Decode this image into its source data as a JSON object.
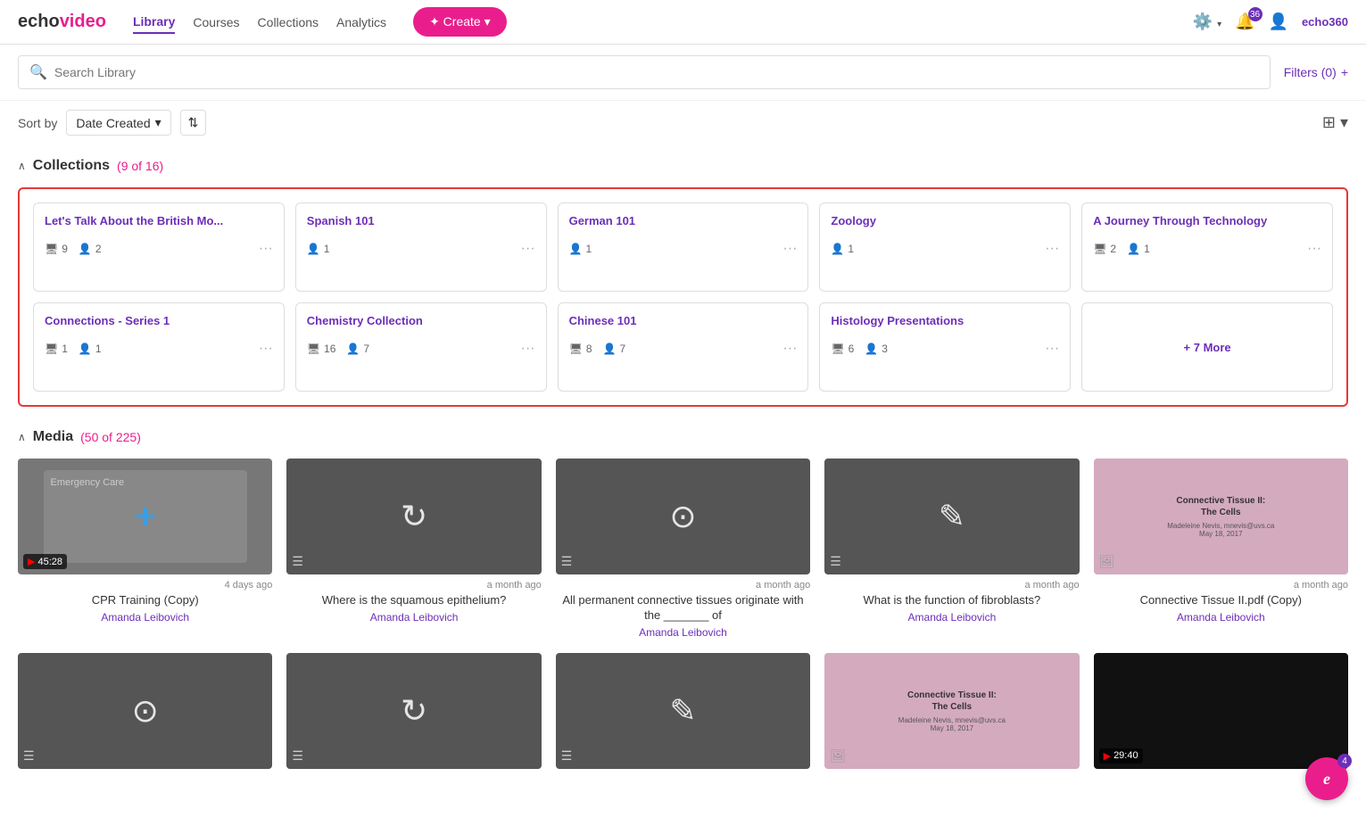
{
  "app": {
    "name_echo": "echo",
    "name_video": "video"
  },
  "nav": {
    "items": [
      {
        "label": "Library",
        "active": true
      },
      {
        "label": "Courses",
        "active": false
      },
      {
        "label": "Collections",
        "active": false
      },
      {
        "label": "Analytics",
        "active": false
      }
    ],
    "create_label": "✦ Create ▾"
  },
  "header_right": {
    "settings_label": "⚙",
    "bell_label": "🔔",
    "bell_badge": "36",
    "avatar_label": "👤",
    "brand_label": "echo360"
  },
  "search": {
    "placeholder": "Search Library",
    "filters_label": "Filters (0)",
    "filters_plus": "+"
  },
  "sort": {
    "label": "Sort by",
    "selected": "Date Created",
    "sort_icon": "⇅",
    "view_icon": "⊞ ▾"
  },
  "collections_section": {
    "title": "Collections",
    "count": "(9 of 16)",
    "chevron": "∧",
    "cards": [
      {
        "title": "Let's Talk About the British Mo...",
        "media_count": "9",
        "people_count": "2"
      },
      {
        "title": "Spanish 101",
        "media_count": "",
        "people_count": "1"
      },
      {
        "title": "German 101",
        "media_count": "",
        "people_count": "1"
      },
      {
        "title": "Zoology",
        "media_count": "",
        "people_count": "1"
      },
      {
        "title": "A Journey Through Technology",
        "media_count": "2",
        "people_count": "1"
      },
      {
        "title": "Connections - Series 1",
        "media_count": "1",
        "people_count": "1"
      },
      {
        "title": "Chemistry Collection",
        "media_count": "16",
        "people_count": "7"
      },
      {
        "title": "Chinese 101",
        "media_count": "8",
        "people_count": "7"
      },
      {
        "title": "Histology Presentations",
        "media_count": "6",
        "people_count": "3"
      }
    ],
    "more_label": "+ 7 More"
  },
  "media_section": {
    "title": "Media",
    "count": "(50 of 225)",
    "chevron": "∧",
    "items": [
      {
        "date": "4 days ago",
        "title": "CPR Training (Copy)",
        "author": "Amanda Leibovich",
        "thumb_type": "cpr",
        "duration": "45:28"
      },
      {
        "date": "a month ago",
        "title": "Where is the squamous epithelium?",
        "author": "Amanda Leibovich",
        "thumb_type": "quiz",
        "duration": ""
      },
      {
        "date": "a month ago",
        "title": "All permanent connective tissues originate with the _______ of",
        "author": "Amanda Leibovich",
        "thumb_type": "record",
        "duration": ""
      },
      {
        "date": "a month ago",
        "title": "What is the function of fibroblasts?",
        "author": "Amanda Leibovich",
        "thumb_type": "edit",
        "duration": ""
      },
      {
        "date": "a month ago",
        "title": "Connective Tissue II.pdf (Copy)",
        "author": "Amanda Leibovich",
        "thumb_type": "presentation",
        "duration": ""
      }
    ],
    "row2": [
      {
        "date": "",
        "title": "",
        "author": "",
        "thumb_type": "record",
        "duration": ""
      },
      {
        "date": "",
        "title": "",
        "author": "",
        "thumb_type": "quiz",
        "duration": ""
      },
      {
        "date": "",
        "title": "",
        "author": "",
        "thumb_type": "edit",
        "duration": ""
      },
      {
        "date": "",
        "title": "",
        "author": "",
        "thumb_type": "presentation2",
        "duration": ""
      },
      {
        "date": "",
        "title": "",
        "author": "",
        "thumb_type": "black_video",
        "duration": "29:40"
      }
    ]
  },
  "chat": {
    "icon": "e",
    "badge": "4"
  }
}
